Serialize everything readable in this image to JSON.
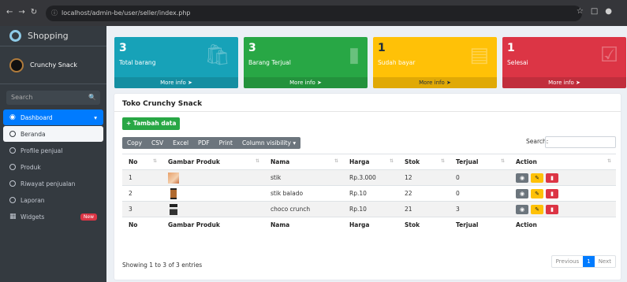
{
  "browser": {
    "url": "localhost/admin-be/user/seller/index.php"
  },
  "sidebar": {
    "brand": "Shopping",
    "user": "Crunchy Snack",
    "search_placeholder": "Search",
    "items": [
      {
        "label": "Dashboard"
      },
      {
        "label": "Beranda"
      },
      {
        "label": "Profile penjual"
      },
      {
        "label": "Produk"
      },
      {
        "label": "Riwayat penjualan"
      },
      {
        "label": "Laporan"
      },
      {
        "label": "Widgets",
        "badge": "New"
      }
    ]
  },
  "boxes": [
    {
      "num": "3",
      "label": "Total barang",
      "foot": "More info",
      "color": "#17a2b8"
    },
    {
      "num": "3",
      "label": "Barang Terjual",
      "foot": "More info",
      "color": "#28a745"
    },
    {
      "num": "1",
      "label": "Sudah bayar",
      "foot": "More info",
      "color": "#ffc107"
    },
    {
      "num": "1",
      "label": "Selesai",
      "foot": "More info",
      "color": "#dc3545"
    }
  ],
  "card": {
    "title": "Toko Crunchy Snack",
    "add_label": "Tambah data",
    "dt_buttons": [
      "Copy",
      "CSV",
      "Excel",
      "PDF",
      "Print",
      "Column visibility"
    ],
    "search_label": "Search:",
    "headers": [
      "No",
      "Gambar Produk",
      "Nama",
      "Harga",
      "Stok",
      "Terjual",
      "Action"
    ],
    "rows": [
      {
        "no": "1",
        "nama": "stik",
        "harga": "Rp.3.000",
        "stok": "12",
        "terjual": "0"
      },
      {
        "no": "2",
        "nama": "stik balado",
        "harga": "Rp.10",
        "stok": "22",
        "terjual": "0"
      },
      {
        "no": "3",
        "nama": "choco crunch",
        "harga": "Rp.10",
        "stok": "21",
        "terjual": "3"
      }
    ],
    "showing": "Showing 1 to 3 of 3 entries",
    "pager": {
      "prev": "Previous",
      "current": "1",
      "next": "Next"
    }
  }
}
